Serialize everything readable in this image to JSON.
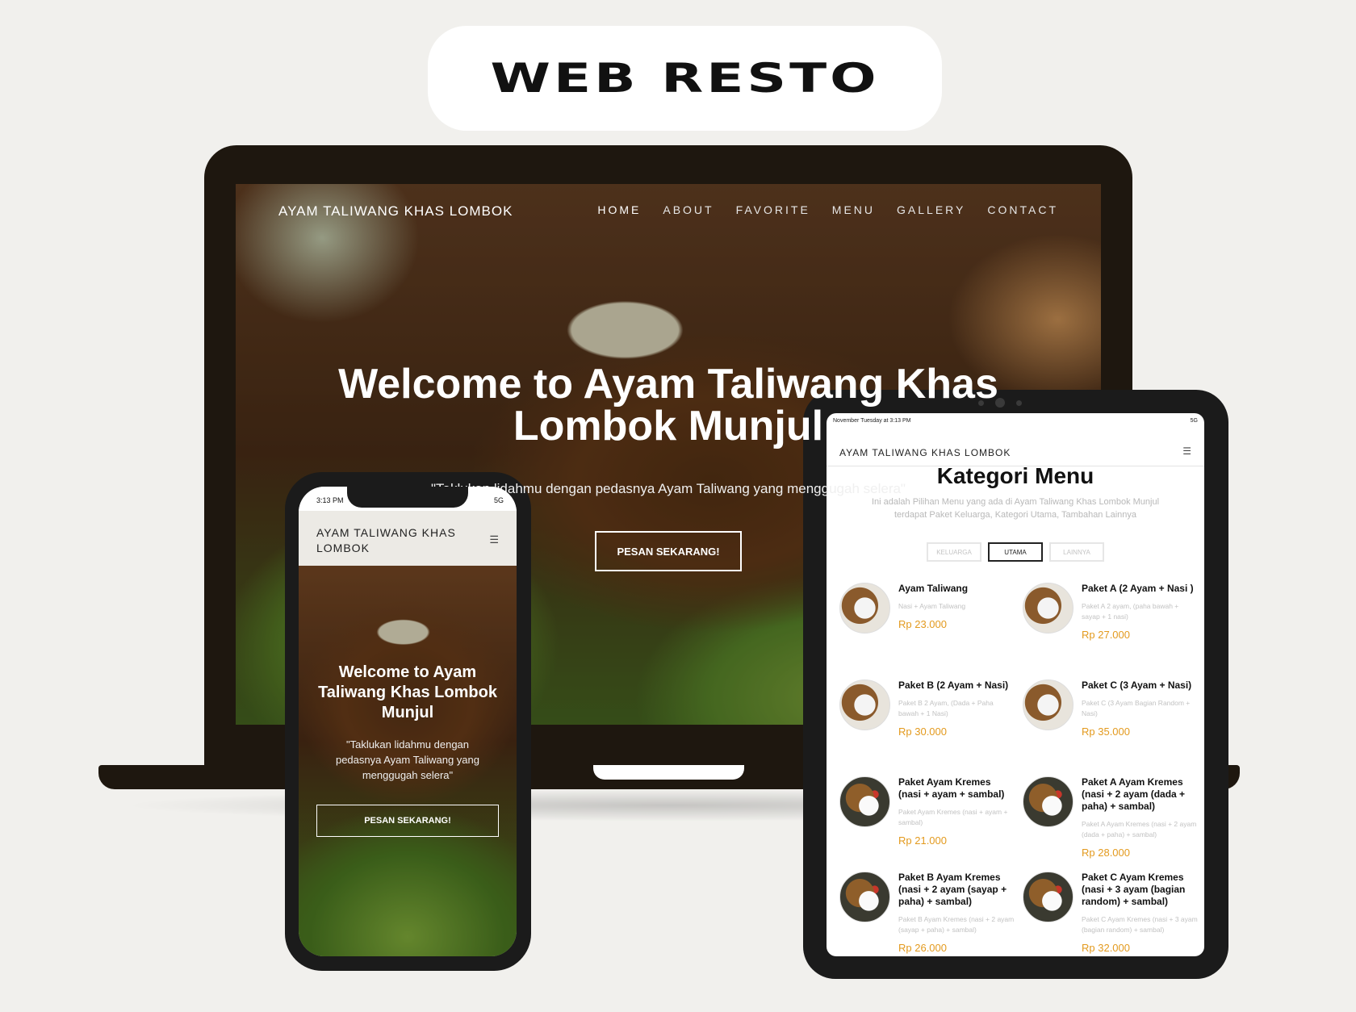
{
  "title": "WEB RESTO",
  "laptop": {
    "brand": "AYAM TALIWANG KHAS LOMBOK",
    "nav": [
      "HOME",
      "ABOUT",
      "FAVORITE",
      "MENU",
      "GALLERY",
      "CONTACT"
    ],
    "hero_title_line1": "Welcome to Ayam Taliwang Khas",
    "hero_title_line2": "Lombok Munjul",
    "hero_subtitle": "\"Taklukan lidahmu dengan pedasnya Ayam Taliwang yang menggugah selera\"",
    "cta": "PESAN SEKARANG!"
  },
  "phone": {
    "time": "3:13 PM",
    "signal": "5G",
    "brand": "AYAM TALIWANG KHAS LOMBOK",
    "menu_icon": "hamburger-icon",
    "hero_title": "Welcome to Ayam Taliwang Khas Lombok Munjul",
    "hero_subtitle": "\"Taklukan lidahmu dengan pedasnya Ayam Taliwang yang menggugah selera\"",
    "cta": "PESAN SEKARANG!"
  },
  "tablet": {
    "status_left": "November Tuesday at 3:13 PM",
    "status_right": "5G",
    "brand": "AYAM TALIWANG KHAS LOMBOK",
    "heading": "Kategori Menu",
    "description": "Ini adalah Pilihan Menu yang ada di Ayam Taliwang Khas Lombok Munjul terdapat Paket Keluarga, Kategori Utama, Tambahan Lainnya",
    "tabs": [
      "KELUARGA",
      "UTAMA",
      "LAINNYA"
    ],
    "active_tab": "UTAMA",
    "items": [
      {
        "name": "Ayam Taliwang",
        "detail": "Nasi + Ayam Taliwang",
        "price": "Rp 23.000"
      },
      {
        "name": "Paket A (2 Ayam + Nasi )",
        "detail": "Paket A 2 ayam, (paha bawah + sayap + 1 nasi)",
        "price": "Rp 27.000"
      },
      {
        "name": "Paket B (2 Ayam + Nasi)",
        "detail": "Paket B 2 Ayam, (Dada + Paha bawah + 1 Nasi)",
        "price": "Rp 30.000"
      },
      {
        "name": "Paket C (3 Ayam + Nasi)",
        "detail": "Paket C (3 Ayam Bagian Random + Nasi)",
        "price": "Rp 35.000"
      },
      {
        "name": "Paket Ayam Kremes (nasi + ayam + sambal)",
        "detail": "Paket Ayam Kremes (nasi + ayam + sambal)",
        "price": "Rp 21.000"
      },
      {
        "name": "Paket A Ayam Kremes (nasi + 2 ayam (dada + paha) + sambal)",
        "detail": "Paket A Ayam Kremes (nasi + 2 ayam (dada + paha) + sambal)",
        "price": "Rp 28.000"
      },
      {
        "name": "Paket B Ayam Kremes (nasi + 2 ayam (sayap + paha) + sambal)",
        "detail": "Paket B Ayam Kremes (nasi + 2 ayam (sayap + paha) + sambal)",
        "price": "Rp 26.000"
      },
      {
        "name": "Paket C Ayam Kremes (nasi + 3 ayam (bagian random) + sambal)",
        "detail": "Paket C Ayam Kremes (nasi + 3 ayam (bagian random) + sambal)",
        "price": "Rp 32.000"
      }
    ]
  }
}
